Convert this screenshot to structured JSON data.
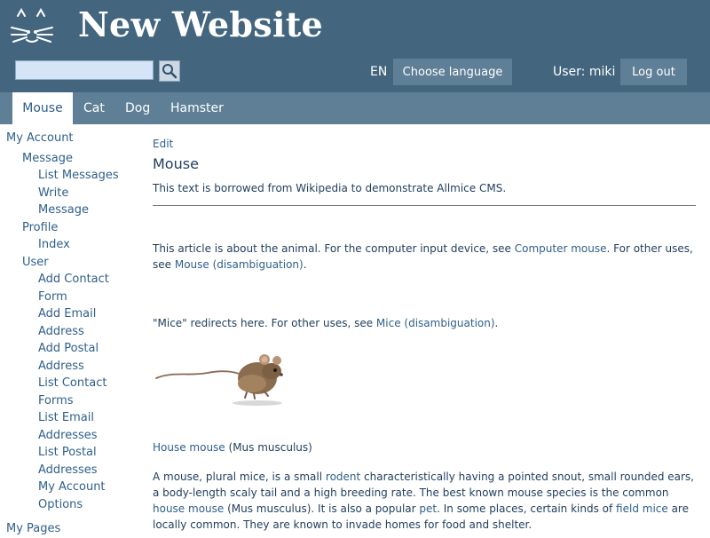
{
  "header": {
    "site_title": "New Website",
    "search_input_value": "",
    "search_button_icon": "magnifier-icon",
    "language_code": "EN",
    "choose_language_label": "Choose language",
    "user_label": "User: miki",
    "logout_label": "Log out",
    "colors": {
      "header_bg": "#43657e",
      "tab_bar_bg": "#5f7f97",
      "button_bg": "#5f7f97",
      "search_bg": "#d6e4f7"
    }
  },
  "tabs": [
    {
      "label": "Mouse",
      "active": true
    },
    {
      "label": "Cat",
      "active": false
    },
    {
      "label": "Dog",
      "active": false
    },
    {
      "label": "Hamster",
      "active": false
    }
  ],
  "sidebar": {
    "lines": [
      "My Account",
      "Message",
      "List Messages",
      "Write",
      "Message",
      "Profile",
      "Index",
      "User",
      "Add Contact",
      "Form",
      "Add Email",
      "Address",
      "Add Postal",
      "Address",
      "List Contact",
      "Forms",
      "List Email",
      "Addresses",
      "List Postal",
      "Addresses",
      "My Account",
      "Options",
      "My Pages"
    ]
  },
  "article": {
    "edit_label": "Edit",
    "title": "Mouse",
    "intro": "This text is borrowed from Wikipedia to demonstrate Allmice CMS.",
    "hatnote1": {
      "a": "This article is about the animal. For the computer input device, see ",
      "link1": "Computer mouse",
      "b": ". For other uses, see ",
      "link2": "Mouse (disambiguation)",
      "c": "."
    },
    "hatnote2": {
      "a": "\"Mice\" redirects here. For other uses, see ",
      "link": "Mice (disambiguation)",
      "b": "."
    },
    "caption": {
      "link": "House mouse",
      "rest": " (Mus musculus)"
    },
    "body": {
      "p1": "A mouse, plural mice, is a small ",
      "rodent": "rodent",
      "p2": " characteristically having a pointed snout, small rounded ears, a body-length scaly tail and a high breeding rate. The best known mouse species is the common ",
      "house_mouse": "house mouse",
      "p3": " (Mus musculus). It is also a popular ",
      "pet": "pet",
      "p4": ". In some places, certain kinds of ",
      "field_mice": "field mice",
      "p5": " are locally common. They are known to invade homes for food and shelter."
    }
  }
}
